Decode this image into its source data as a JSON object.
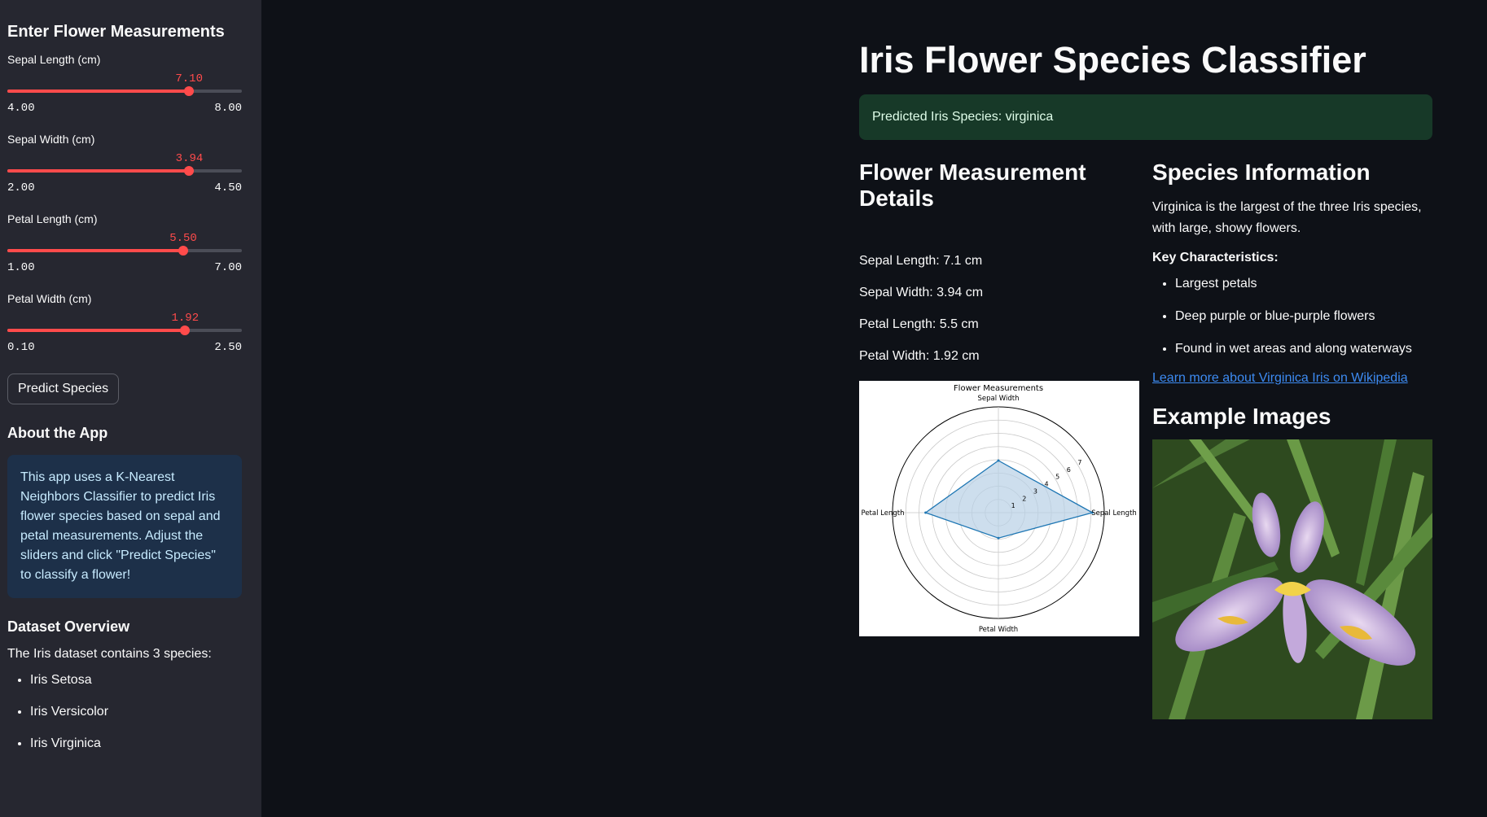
{
  "sidebar": {
    "title": "Enter Flower Measurements",
    "sliders": [
      {
        "label": "Sepal Length (cm)",
        "value": "7.10",
        "min": "4.00",
        "max": "8.00",
        "fraction": 0.775
      },
      {
        "label": "Sepal Width (cm)",
        "value": "3.94",
        "min": "2.00",
        "max": "4.50",
        "fraction": 0.776
      },
      {
        "label": "Petal Length (cm)",
        "value": "5.50",
        "min": "1.00",
        "max": "7.00",
        "fraction": 0.75
      },
      {
        "label": "Petal Width (cm)",
        "value": "1.92",
        "min": "0.10",
        "max": "2.50",
        "fraction": 0.758
      }
    ],
    "predict_button": "Predict Species",
    "about_heading": "About the App",
    "about_text": "This app uses a K-Nearest Neighbors Classifier to predict Iris flower species based on sepal and petal measurements. Adjust the sliders and click \"Predict Species\" to classify a flower!",
    "dataset_heading": "Dataset Overview",
    "dataset_text": "The Iris dataset contains 3 species:",
    "species": [
      "Iris Setosa",
      "Iris Versicolor",
      "Iris Virginica"
    ]
  },
  "main": {
    "title": "Iris Flower Species Classifier",
    "prediction": "Predicted Iris Species: virginica",
    "measurements_heading": "Flower Measurement Details",
    "measurements": [
      "Sepal Length: 7.1 cm",
      "Sepal Width: 3.94 cm",
      "Petal Length: 5.5 cm",
      "Petal Width: 1.92 cm"
    ],
    "species_heading": "Species Information",
    "species_desc": "Virginica is the largest of the three Iris species, with large, showy flowers.",
    "key_heading": "Key Characteristics:",
    "characteristics": [
      "Largest petals",
      "Deep purple or blue-purple flowers",
      "Found in wet areas and along waterways"
    ],
    "wiki_link": "Learn more about Virginica Iris on Wikipedia",
    "examples_heading": "Example Images"
  },
  "chart_data": {
    "type": "radar",
    "title": "Flower Measurements",
    "categories": [
      "Sepal Length",
      "Sepal Width",
      "Petal Length",
      "Petal Width"
    ],
    "values": [
      7.1,
      3.94,
      5.5,
      1.92
    ],
    "rlim": [
      0,
      8
    ],
    "radial_ticks": [
      "1",
      "2",
      "3",
      "4",
      "5",
      "6",
      "7"
    ],
    "grid": true,
    "fill_color": "#b8d0e6",
    "line_color": "#1f77b4"
  },
  "colors": {
    "accent": "#ff4b4b",
    "success_bg": "#173928",
    "info_bg": "#1d3049",
    "link": "#3d8bf2"
  }
}
